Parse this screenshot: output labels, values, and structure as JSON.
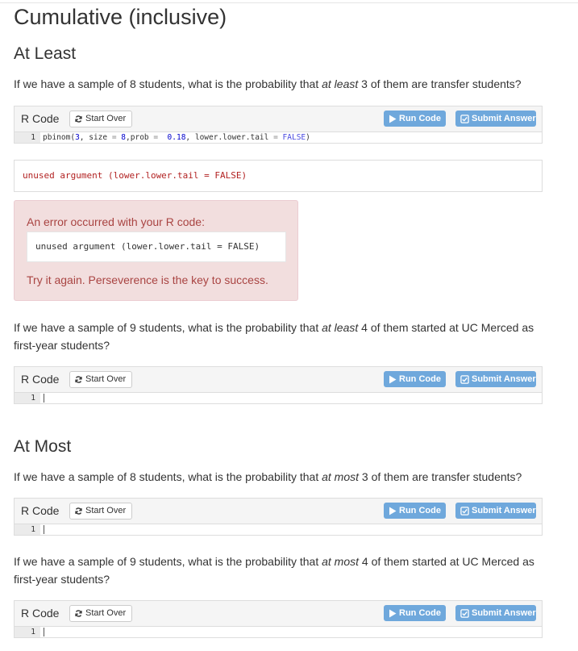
{
  "page": {
    "title": "Cumulative (inclusive)"
  },
  "sections": {
    "at_least": "At Least",
    "at_most": "At Most"
  },
  "questions": {
    "q1": {
      "pre": "If we have a sample of 8 students, what is the probability that ",
      "em": "at least",
      "post": " 3 of them are transfer students?"
    },
    "q2": {
      "pre": "If we have a sample of 9 students, what is the probability that ",
      "em": "at least",
      "post": " 4 of them started at UC Merced as first-year students?"
    },
    "q3": {
      "pre": "If we have a sample of 8 students, what is the probability that ",
      "em": "at most",
      "post": " 3 of them are transfer students?"
    },
    "q4": {
      "pre": "If we have a sample of 9 students, what is the probability that ",
      "em": "at most",
      "post": " 4 of them started at UC Merced as first-year students?"
    }
  },
  "exercise": {
    "label": "R Code",
    "start_over": "Start Over",
    "run_code": "Run Code",
    "submit_answer": "Submit Answer",
    "line_number": "1"
  },
  "code": {
    "fn": "pbinom",
    "paren_open": "(",
    "arg1": "3",
    "sep1": ", size ",
    "eq1": "=",
    "size_val": " 8",
    "sep2": ",prob ",
    "eq2": "=",
    "prob_val": "  0.18",
    "sep3": ", lower.lower.tail ",
    "eq3": "=",
    "false_val": " FALSE",
    "paren_close": ")"
  },
  "output": {
    "text": "unused argument (lower.lower.tail = FALSE)"
  },
  "error_alert": {
    "message": "An error occurred with your R code:",
    "code": "unused argument (lower.lower.tail = FALSE)",
    "hint": "Try it again. Perseverence is the key to success."
  },
  "colors": {
    "button_blue": "#6fa8dc",
    "alert_bg": "#f2dede",
    "alert_text": "#a94442",
    "output_red": "#b22222"
  }
}
